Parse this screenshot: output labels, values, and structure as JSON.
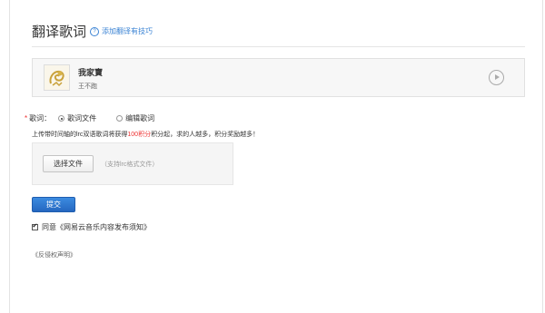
{
  "page": {
    "title": "翻译歌词",
    "tips_link": "添加翻译有技巧"
  },
  "song": {
    "name": "我家寶",
    "artist": "王不跑",
    "cover_icon": "dragon-cover-icon",
    "play_icon": "play-circle-icon"
  },
  "lyric_option": {
    "label": "歌词：",
    "options": [
      "歌词文件",
      "编辑歌词"
    ],
    "selected": "歌词文件"
  },
  "hint": {
    "prefix": "上传带时间轴的lrc双语歌词将获得",
    "points": "100积分",
    "suffix": "积分起，求的人越多，积分奖励越多！"
  },
  "upload": {
    "button": "选择文件",
    "note": "（支持lrc格式文件）"
  },
  "submit_label": "提交",
  "agree": {
    "checked": true,
    "text": "同意《网易云音乐内容发布须知》"
  },
  "feedback_link": "《反侵权声明》",
  "colors": {
    "link": "#3a83d4",
    "accent_red": "#e33333",
    "button_blue": "#2d74cf"
  }
}
